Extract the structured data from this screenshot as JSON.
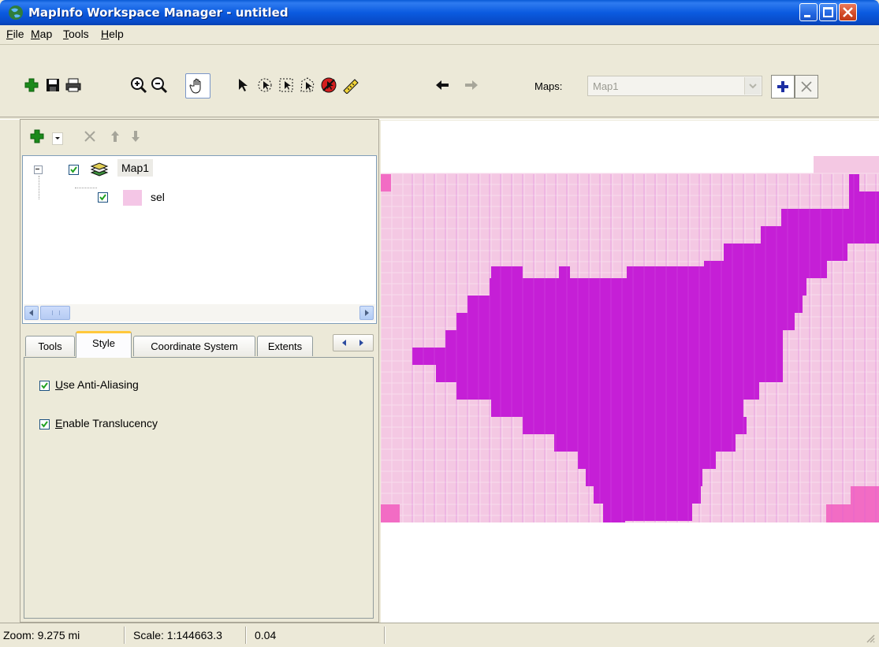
{
  "window": {
    "title": "MapInfo Workspace Manager - untitled"
  },
  "menu": [
    {
      "label": "File",
      "key": "F",
      "rest": "ile"
    },
    {
      "label": "Map",
      "key": "M",
      "rest": "ap"
    },
    {
      "label": "Tools",
      "key": "T",
      "rest": "ools"
    },
    {
      "label": "Help",
      "key": "H",
      "rest": "elp"
    }
  ],
  "toolbar": {
    "icons": [
      "add-icon",
      "save-icon",
      "print-icon",
      "zoom-in-icon",
      "zoom-out-icon",
      "pan-hand-icon",
      "select-arrow-icon",
      "radius-select-icon",
      "marquee-select-icon",
      "polygon-select-icon",
      "clear-select-icon",
      "info-tool-icon",
      "back-arrow-icon",
      "forward-arrow-icon"
    ],
    "maps_label": "Maps:",
    "maps_value": "Map1"
  },
  "layers": {
    "root": {
      "label": "Map1",
      "checked": true
    },
    "children": [
      {
        "label": "sel",
        "checked": true,
        "swatch": "#f4c6e6"
      }
    ]
  },
  "tabs": [
    {
      "label": "Tools",
      "active": false
    },
    {
      "label": "Style",
      "active": true
    },
    {
      "label": "Coordinate System",
      "active": false
    },
    {
      "label": "Extents",
      "active": false
    }
  ],
  "style_options": [
    {
      "label_key": "U",
      "label_rest": "se Anti-Aliasing",
      "checked": true
    },
    {
      "label_key": "E",
      "label_rest": "nable Translucency",
      "checked": true
    }
  ],
  "status": {
    "zoom": "Zoom: 9.275 mi",
    "scale": "Scale: 1:144663.3",
    "value": "0.04"
  },
  "colors": {
    "light_fill": "#f4c8e3",
    "mid_fill": "#f26cc4",
    "selected_fill": "#c51fd6"
  }
}
